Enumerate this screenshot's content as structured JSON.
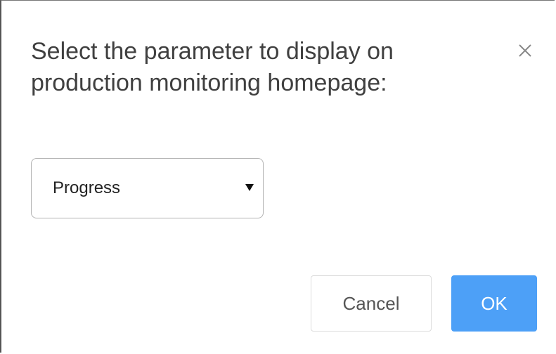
{
  "dialog": {
    "title": "Select the parameter to display on production monitoring homepage:",
    "close_icon": "close-icon",
    "select": {
      "value": "Progress",
      "caret_icon": "caret-down-icon"
    },
    "buttons": {
      "cancel_label": "Cancel",
      "ok_label": "OK"
    }
  },
  "colors": {
    "primary": "#4da0f7",
    "title_text": "#404040",
    "border": "#b3b3b3"
  }
}
